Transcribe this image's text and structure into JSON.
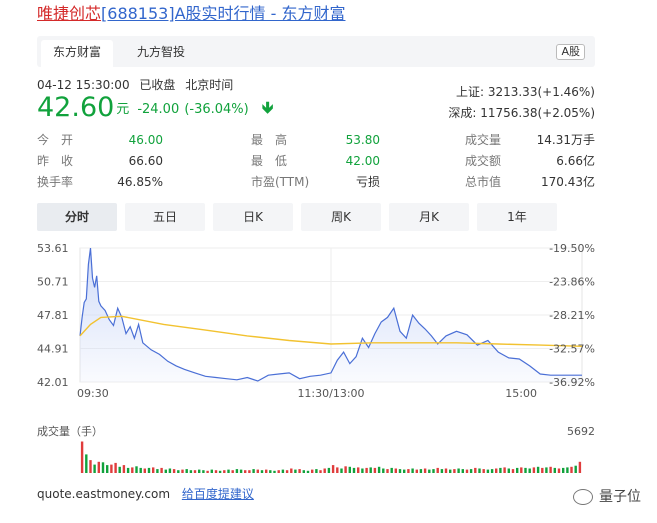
{
  "title": {
    "name": "唯捷创芯",
    "rest": "[688153]A股实时行情 - 东方财富"
  },
  "tabs": [
    {
      "label": "东方财富"
    },
    {
      "label": "九方智投"
    }
  ],
  "market_badge": "A股",
  "quote": {
    "datetime": "04-12 15:30:00",
    "status": "已收盘",
    "timezone": "北京时间",
    "price": "42.60",
    "unit": "元",
    "change": "-24.00",
    "change_pct": "(-36.04%)"
  },
  "index": {
    "sh": {
      "label": "上证:",
      "value": "3213.33(+1.46%)"
    },
    "sz": {
      "label": "深成:",
      "value": "11756.38(+2.05%)"
    }
  },
  "stats": [
    [
      {
        "label": "今　开",
        "value": "46.00"
      },
      {
        "label": "最　高",
        "value": "53.80"
      },
      {
        "label": "成交量",
        "value": "14.31万手"
      }
    ],
    [
      {
        "label": "昨　收",
        "value": "66.60"
      },
      {
        "label": "最　低",
        "value": "42.00"
      },
      {
        "label": "成交额",
        "value": "6.66亿"
      }
    ],
    [
      {
        "label": "换手率",
        "value": "46.85%"
      },
      {
        "label": "市盈(TTM)",
        "value": "亏损"
      },
      {
        "label": "总市值",
        "value": "170.43亿"
      }
    ]
  ],
  "periods": [
    {
      "label": "分时"
    },
    {
      "label": "五日"
    },
    {
      "label": "日K"
    },
    {
      "label": "周K"
    },
    {
      "label": "月K"
    },
    {
      "label": "1年"
    }
  ],
  "colors": {
    "up": "#e03c3c",
    "down": "#11a23c",
    "price_line": "#4a6fd6",
    "avg_line": "#f2c230",
    "link": "#3266cc"
  },
  "chart_data": {
    "type": "line",
    "y_ticks": [
      "53.61",
      "50.71",
      "47.81",
      "44.91",
      "42.01"
    ],
    "pct_ticks": [
      "-19.50%",
      "-23.86%",
      "-28.21%",
      "-32.57%",
      "-36.92%"
    ],
    "ylim": [
      42.01,
      53.61
    ],
    "x_ticks": [
      "09:30",
      "11:30/13:00",
      "15:00"
    ],
    "x_tick_pos": [
      0,
      120,
      240
    ],
    "x_range": [
      0,
      240
    ],
    "series": [
      {
        "x": [
          0,
          1,
          2,
          3,
          4,
          5,
          6,
          7,
          8,
          9,
          10,
          12,
          14,
          16,
          18,
          20,
          22,
          24,
          26,
          28,
          30,
          34,
          38,
          42,
          46,
          50,
          55,
          60,
          65,
          70,
          75,
          80,
          85,
          90,
          95,
          100,
          105,
          110,
          115,
          120,
          123,
          126,
          129,
          132,
          135,
          138,
          141,
          144,
          147,
          150,
          153,
          156,
          159,
          162,
          165,
          168,
          171,
          175,
          180,
          185,
          190,
          195,
          200,
          205,
          210,
          215,
          220,
          225,
          230,
          235,
          240
        ],
        "y": [
          46.0,
          47.6,
          48.9,
          49.2,
          52.2,
          53.6,
          51.0,
          50.2,
          51.2,
          49.0,
          48.6,
          48.2,
          47.4,
          46.9,
          48.4,
          47.6,
          46.2,
          46.8,
          45.8,
          47.0,
          45.4,
          44.8,
          44.4,
          43.8,
          43.4,
          43.1,
          42.8,
          42.5,
          42.4,
          42.3,
          42.2,
          42.4,
          42.1,
          42.6,
          42.7,
          42.8,
          42.3,
          42.5,
          42.6,
          42.8,
          43.9,
          44.6,
          43.6,
          44.2,
          45.8,
          45.0,
          46.2,
          47.2,
          47.6,
          48.4,
          46.4,
          45.8,
          47.8,
          47.1,
          46.6,
          46.0,
          45.3,
          46.0,
          46.4,
          46.1,
          45.2,
          45.6,
          44.6,
          44.1,
          44.0,
          43.4,
          42.7,
          42.6,
          42.6,
          42.6,
          42.6
        ]
      },
      {
        "x": [
          0,
          5,
          10,
          20,
          40,
          60,
          80,
          100,
          120,
          140,
          160,
          180,
          200,
          220,
          240
        ],
        "y": [
          46.0,
          47.0,
          47.6,
          47.7,
          47.0,
          46.5,
          46.0,
          45.6,
          45.3,
          45.4,
          45.4,
          45.4,
          45.3,
          45.2,
          45.1
        ]
      }
    ],
    "volume": {
      "label": "成交量（手）",
      "max_label": "5692",
      "max": 5692,
      "x": [
        1,
        3,
        5,
        7,
        9,
        11,
        13,
        15,
        17,
        19,
        21,
        23,
        25,
        27,
        29,
        31,
        33,
        35,
        37,
        39,
        41,
        43,
        45,
        47,
        49,
        51,
        53,
        55,
        57,
        59,
        61,
        63,
        65,
        67,
        69,
        71,
        73,
        75,
        77,
        79,
        81,
        83,
        85,
        87,
        89,
        91,
        93,
        95,
        97,
        99,
        101,
        103,
        105,
        107,
        109,
        111,
        113,
        115,
        117,
        119,
        121,
        123,
        125,
        127,
        129,
        131,
        133,
        135,
        137,
        139,
        141,
        143,
        145,
        147,
        149,
        151,
        153,
        155,
        157,
        159,
        161,
        163,
        165,
        167,
        169,
        171,
        173,
        175,
        177,
        179,
        181,
        183,
        185,
        187,
        189,
        191,
        193,
        195,
        197,
        199,
        201,
        203,
        205,
        207,
        209,
        211,
        213,
        215,
        217,
        219,
        221,
        223,
        225,
        227,
        229,
        231,
        233,
        235,
        237,
        239
      ],
      "values": [
        5600,
        3300,
        2300,
        1500,
        2000,
        1900,
        1400,
        1500,
        1800,
        1100,
        1400,
        900,
        1000,
        1200,
        900,
        800,
        900,
        1000,
        700,
        900,
        600,
        800,
        700,
        500,
        600,
        700,
        500,
        500,
        600,
        500,
        400,
        600,
        500,
        400,
        500,
        600,
        500,
        700,
        600,
        500,
        500,
        700,
        600,
        500,
        600,
        500,
        400,
        500,
        600,
        500,
        800,
        600,
        700,
        500,
        400,
        600,
        700,
        500,
        800,
        900,
        1400,
        1000,
        800,
        1200,
        1100,
        900,
        1000,
        800,
        900,
        1000,
        900,
        1100,
        800,
        700,
        900,
        800,
        700,
        600,
        700,
        800,
        600,
        700,
        800,
        600,
        700,
        900,
        700,
        800,
        600,
        700,
        800,
        700,
        600,
        700,
        900,
        800,
        700,
        600,
        700,
        800,
        900,
        1000,
        800,
        700,
        900,
        1000,
        900,
        800,
        1000,
        1100,
        900,
        1000,
        1100,
        900,
        800,
        900,
        1000,
        1100,
        1300,
        2000
      ],
      "direction": [
        "u",
        "d",
        "u",
        "d",
        "u",
        "d",
        "d",
        "u",
        "u",
        "d",
        "u",
        "d",
        "u",
        "d",
        "d",
        "u",
        "d",
        "u",
        "d",
        "u",
        "d",
        "d",
        "u",
        "d",
        "u",
        "d",
        "d",
        "u",
        "d",
        "d",
        "u",
        "d",
        "u",
        "d",
        "u",
        "d",
        "u",
        "d",
        "d",
        "u",
        "u",
        "d",
        "u",
        "d",
        "u",
        "d",
        "d",
        "u",
        "d",
        "u",
        "u",
        "d",
        "u",
        "d",
        "d",
        "u",
        "d",
        "u",
        "u",
        "d",
        "u",
        "u",
        "d",
        "u",
        "d",
        "d",
        "u",
        "d",
        "u",
        "d",
        "u",
        "d",
        "d",
        "u",
        "d",
        "u",
        "d",
        "d",
        "u",
        "d",
        "u",
        "d",
        "u",
        "d",
        "d",
        "u",
        "d",
        "u",
        "d",
        "u",
        "d",
        "d",
        "u",
        "d",
        "u",
        "d",
        "u",
        "d",
        "d",
        "u",
        "d",
        "u",
        "d",
        "u",
        "d",
        "u",
        "d",
        "d",
        "u",
        "d",
        "u",
        "d",
        "u",
        "d",
        "u",
        "d",
        "d",
        "u",
        "d",
        "u"
      ]
    }
  },
  "footer": {
    "site": "quote.eastmoney.com",
    "feedback": "给百度提建议"
  },
  "watermark": "量子位"
}
